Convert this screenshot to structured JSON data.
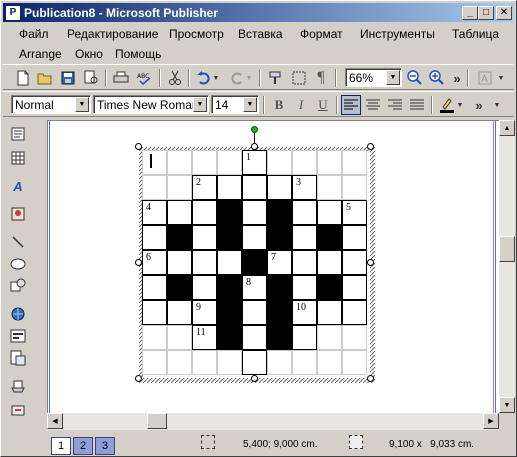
{
  "window": {
    "title": "Publication8 - Microsoft Publisher",
    "icon_letter": "P",
    "controls": {
      "minimize": "_",
      "maximize": "□",
      "close": "✕"
    }
  },
  "menu": {
    "items": [
      "Файл",
      "Редактирование",
      "Просмотр",
      "Вставка",
      "Формат",
      "Инструменты",
      "Таблица",
      "Arrange",
      "Окно",
      "Помощь"
    ]
  },
  "standard_toolbar": {
    "zoom_value": "66%",
    "overflow": "»"
  },
  "format_toolbar": {
    "style_value": "Normal",
    "font_value": "Times New Roman",
    "size_value": "14",
    "bold": "B",
    "italic": "I",
    "underline": "U",
    "overflow": "»"
  },
  "crossword": {
    "numbers": [
      "1",
      "2",
      "3",
      "4",
      "5",
      "6",
      "7",
      "8",
      "9",
      "10",
      "11"
    ]
  },
  "status": {
    "pages": [
      "1",
      "2",
      "3"
    ],
    "position": "5,400; 9,000 cm.",
    "size": "9,100 x   9,033 cm."
  },
  "colors": {
    "title_start": "#0a246a",
    "title_end": "#a6caf0",
    "selection_handle_green": "#22aa22",
    "guide_blue": "#4a6fd8",
    "guide_pink": "#d86ad8"
  }
}
